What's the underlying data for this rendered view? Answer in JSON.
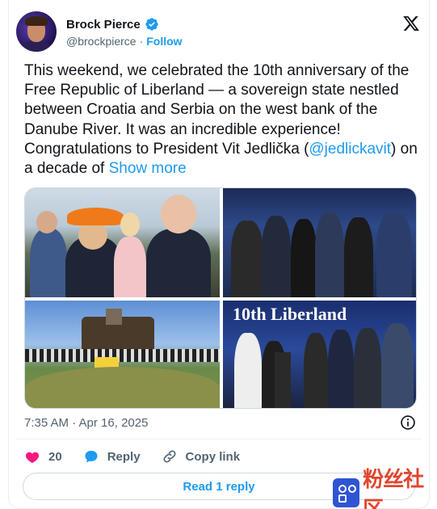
{
  "author": {
    "display_name": "Brock Pierce",
    "handle": "@brockpierce",
    "separator": "·",
    "follow_label": "Follow"
  },
  "tweet": {
    "text_main": "This weekend, we celebrated the 10th anniversary of the Free Republic of Liberland — a sovereign state nestled between Croatia and Serbia on the west bank of the Danube River. It was an incredible experience! Congratulations to President Vit Jedlička (",
    "mention": "@jedlickavit",
    "text_after_mention": ") on a decade of ",
    "show_more": "Show more"
  },
  "media": {
    "photo4_banner": "10th Liberland"
  },
  "meta": {
    "timestamp": "7:35 AM · Apr 16, 2025"
  },
  "actions": {
    "like_count": "20",
    "reply_label": "Reply",
    "copy_link_label": "Copy link"
  },
  "read_reply_label": "Read 1 reply",
  "watermark": {
    "text": "粉丝社区"
  },
  "colors": {
    "accent": "#1d9bf0",
    "like": "#f91880",
    "text_secondary": "#536471"
  },
  "icons": [
    "verified-badge-icon",
    "x-logo-icon",
    "info-icon",
    "heart-icon",
    "reply-bubble-icon",
    "link-icon"
  ]
}
